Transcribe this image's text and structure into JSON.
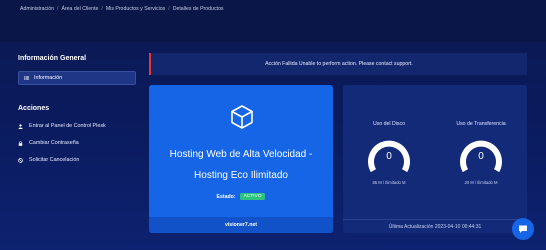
{
  "breadcrumb": {
    "items": [
      "Administración",
      "Área del Cliente",
      "Mis Productos y Servicios",
      "Detalles de Productos"
    ],
    "separator": "/"
  },
  "sidebar": {
    "info_heading": "Información General",
    "info_item": "Información",
    "actions_heading": "Acciones",
    "actions": [
      "Entrar al Panel de Control Plesk",
      "Cambiar Contraseña",
      "Solicitar Cancelación"
    ]
  },
  "alert": {
    "message": "Acción Fallida Unable to perform action. Please contact support."
  },
  "product": {
    "name_line1": "Hosting Web de Alta Velocidad -",
    "name_line2": "Hosting Eco Ilimitado",
    "status_label": "Estado:",
    "status_value": "ACTIVO",
    "domain": "visioner7.net",
    "icon": "box-icon"
  },
  "usage": {
    "disk": {
      "title": "Uso del Disco",
      "value": "0",
      "limit": "85 M / Ilimitado M",
      "fraction": 0
    },
    "bandwidth": {
      "title": "Uso de Transferencia",
      "value": "0",
      "limit": "20 M / Ilimitado M",
      "fraction": 0
    },
    "last_updated": "Última Actualización 2023-04-10 00:44:31"
  },
  "chat": {
    "icon": "chat-icon"
  },
  "colors": {
    "background": "#0c1a52",
    "product_card": "#1565e6",
    "usage_card": "#132a78",
    "alert_border": "#e5383b",
    "badge": "#2ec27e",
    "gauge_track": "#ffffff"
  }
}
